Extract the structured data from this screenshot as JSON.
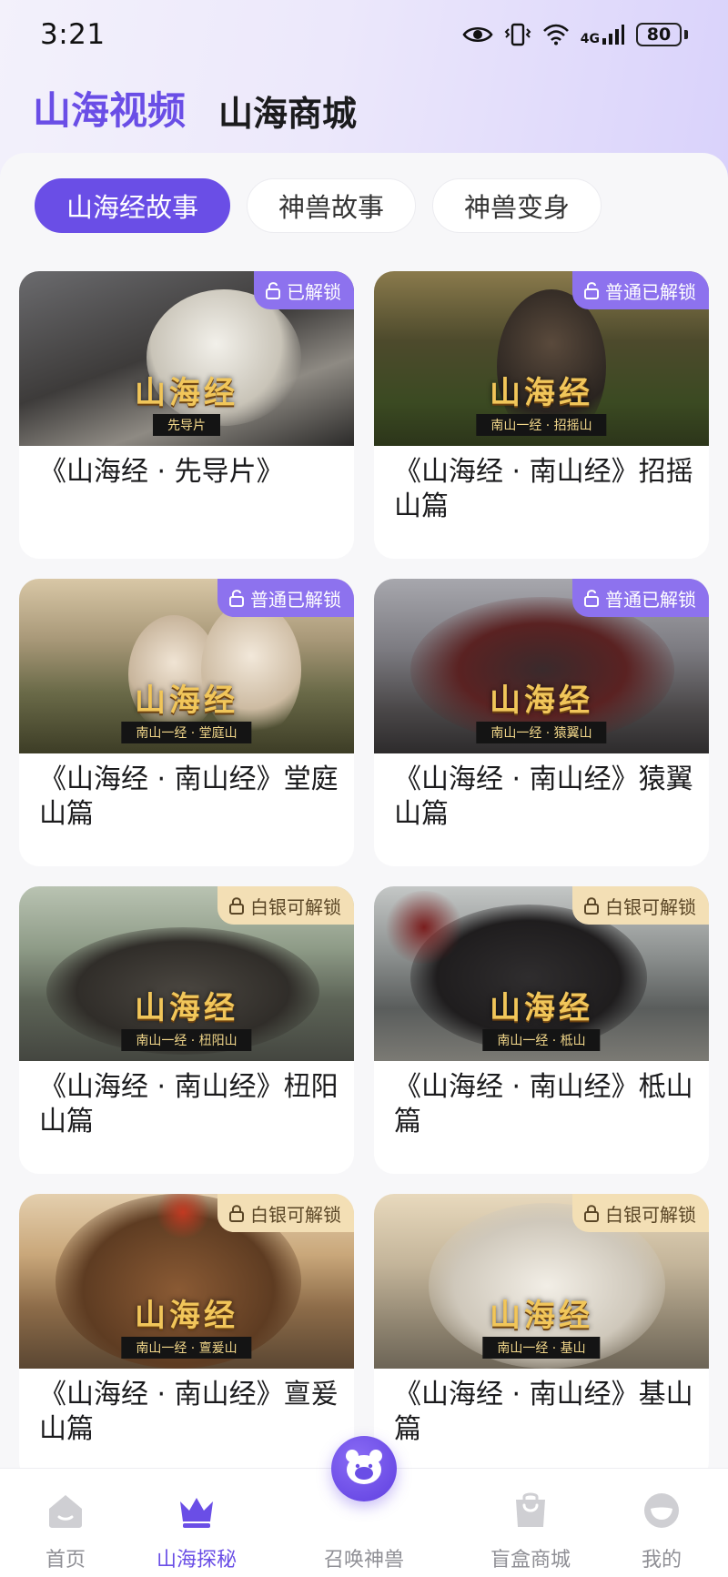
{
  "status_bar": {
    "time": "3:21",
    "network": "4G",
    "battery": "80"
  },
  "top_tabs": [
    {
      "label": "山海视频",
      "active": true
    },
    {
      "label": "山海商城",
      "active": false
    }
  ],
  "chips": [
    {
      "label": "山海经故事",
      "active": true
    },
    {
      "label": "神兽故事",
      "active": false
    },
    {
      "label": "神兽变身",
      "active": false
    }
  ],
  "videos": [
    {
      "badge": "已解锁",
      "badge_type": "unlocked",
      "logo": "山海经",
      "logo_sub": "先导片",
      "title": "《山海经 · 先导片》"
    },
    {
      "badge": "普通已解锁",
      "badge_type": "unlocked",
      "logo": "山海经",
      "logo_sub": "南山一经 · 招摇山",
      "title": "《山海经 · 南山经》招摇山篇"
    },
    {
      "badge": "普通已解锁",
      "badge_type": "unlocked",
      "logo": "山海经",
      "logo_sub": "南山一经 · 堂庭山",
      "title": "《山海经 · 南山经》堂庭山篇"
    },
    {
      "badge": "普通已解锁",
      "badge_type": "unlocked",
      "logo": "山海经",
      "logo_sub": "南山一经 · 猿翼山",
      "title": "《山海经 · 南山经》猿翼山篇"
    },
    {
      "badge": "白银可解锁",
      "badge_type": "silver",
      "logo": "山海经",
      "logo_sub": "南山一经 · 杻阳山",
      "title": "《山海经 · 南山经》杻阳山篇"
    },
    {
      "badge": "白银可解锁",
      "badge_type": "silver",
      "logo": "山海经",
      "logo_sub": "南山一经 · 柢山",
      "title": "《山海经 · 南山经》柢山篇"
    },
    {
      "badge": "白银可解锁",
      "badge_type": "silver",
      "logo": "山海经",
      "logo_sub": "南山一经 · 亶爰山",
      "title": "《山海经 · 南山经》亶爰山篇"
    },
    {
      "badge": "白银可解锁",
      "badge_type": "silver",
      "logo": "山海经",
      "logo_sub": "南山一经 · 基山",
      "title": "《山海经 · 南山经》基山篇"
    }
  ],
  "bottom_nav": [
    {
      "label": "首页",
      "icon": "home-icon",
      "active": false
    },
    {
      "label": "山海探秘",
      "icon": "crown-icon",
      "active": true
    },
    {
      "label": "召唤神兽",
      "icon": "bear-icon",
      "active": false
    },
    {
      "label": "盲盒商城",
      "icon": "bag-icon",
      "active": false
    },
    {
      "label": "我的",
      "icon": "profile-icon",
      "active": false
    }
  ],
  "colors": {
    "accent": "#6a4ee6",
    "badge_unlocked": "#8d72ee",
    "badge_silver": "#f3dfb5"
  }
}
